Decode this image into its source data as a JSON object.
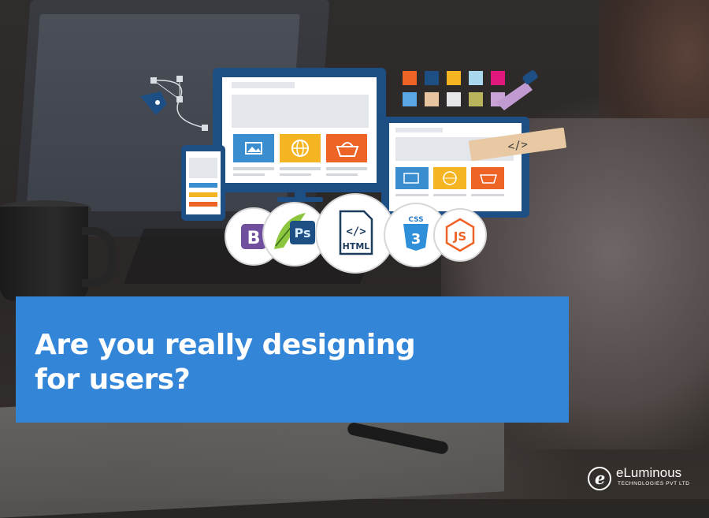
{
  "headline": {
    "line1": "Are you really designing",
    "line2": "for users?"
  },
  "badges": [
    "B",
    "Ps",
    "HTML",
    "CSS",
    "JS"
  ],
  "code_tag": "</>",
  "logo": {
    "mark": "e",
    "name": "eLuminous",
    "tagline": "TECHNOLOGIES PVT LTD"
  },
  "colors": {
    "banner": "#3385d7",
    "monitor": "#1d4f85",
    "tile_blue": "#3a8ed0",
    "tile_yellow": "#f5b523",
    "tile_orange": "#ee6326"
  }
}
